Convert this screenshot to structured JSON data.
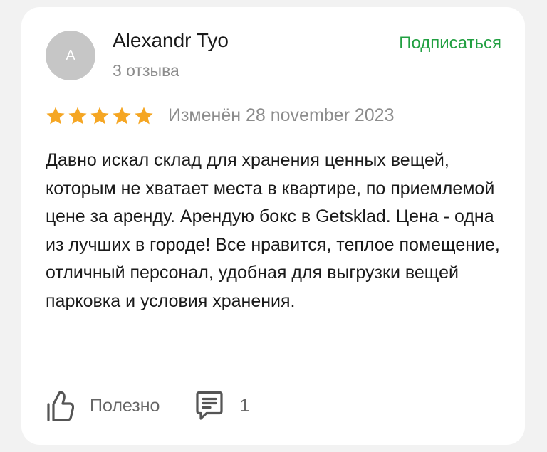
{
  "author": {
    "initial": "A",
    "name": "Alexandr Tyo",
    "reviews_count": "3 отзыва"
  },
  "subscribe_label": "Подписаться",
  "rating": {
    "stars": 5,
    "max": 5,
    "color": "#f5a623"
  },
  "edited_label": "Изменён 28 november 2023",
  "review_text": "Давно искал склад для хранения ценных вещей, которым не хватает места в квартире, по приемлемой цене за аренду. Арендую бокс в Getsklad. Цена - одна из лучших в городе! Все нравится, теплое помещение, отличный персонал, удобная для выгрузки вещей парковка и условия хранения.",
  "actions": {
    "helpful_label": "Полезно",
    "helpful_icon": "thumbs-up-icon",
    "comments_count": "1",
    "comments_icon": "comment-icon"
  },
  "colors": {
    "accent_green": "#22a042",
    "star": "#f5a623",
    "secondary_text": "#8c8c8c"
  }
}
